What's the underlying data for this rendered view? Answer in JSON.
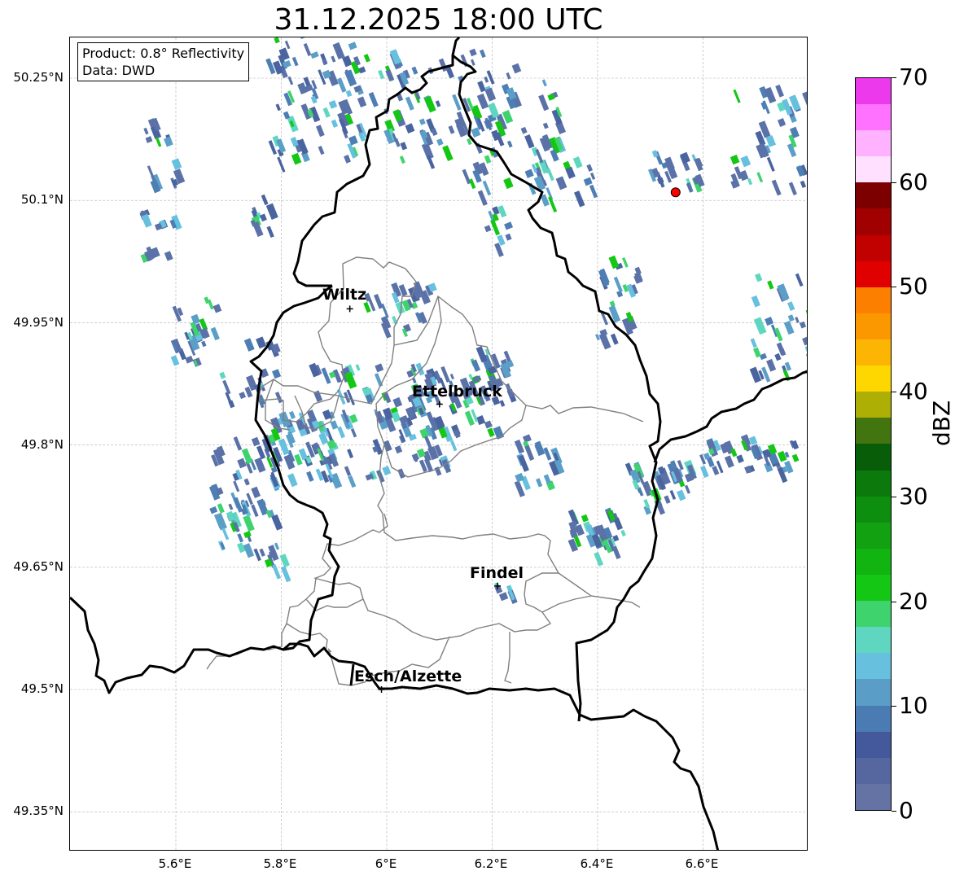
{
  "title": "31.12.2025 18:00 UTC",
  "info": {
    "product": "Product: 0.8° Reflectivity",
    "data": "Data: DWD"
  },
  "lat_labels": [
    "50.25°N",
    "50.1°N",
    "49.95°N",
    "49.8°N",
    "49.65°N",
    "49.5°N",
    "49.35°N"
  ],
  "lon_labels": [
    "5.6°E",
    "5.8°E",
    "6°E",
    "6.2°E",
    "6.4°E",
    "6.6°E"
  ],
  "cities": [
    {
      "name": "Wiltz",
      "lon": 5.93,
      "lat": 49.967
    },
    {
      "name": "Ettelbruck",
      "lon": 6.1,
      "lat": 49.85
    },
    {
      "name": "Findel",
      "lon": 6.21,
      "lat": 49.627
    },
    {
      "name": "Esch/Alzette",
      "lon": 5.99,
      "lat": 49.5
    }
  ],
  "radar_site": {
    "lon": 6.548,
    "lat": 50.11,
    "color": "#ff0000"
  },
  "colorbar": {
    "label": "dBZ",
    "ticks": [
      "0",
      "10",
      "20",
      "30",
      "40",
      "50",
      "60",
      "70"
    ],
    "colors": [
      "#6473a3",
      "#55679e",
      "#44589c",
      "#4a7bb2",
      "#5a9dc7",
      "#66c0de",
      "#5fd7c0",
      "#3ed36c",
      "#14c714",
      "#12b412",
      "#11a111",
      "#0e8e0e",
      "#0c790c",
      "#085d08",
      "#427410",
      "#adaf05",
      "#fed700",
      "#fcb502",
      "#fb9800",
      "#fd7f00",
      "#e10000",
      "#c10000",
      "#a00000",
      "#7c0000",
      "#ffe0ff",
      "#ffb2ff",
      "#ff72ff",
      "#ec39ec"
    ]
  }
}
